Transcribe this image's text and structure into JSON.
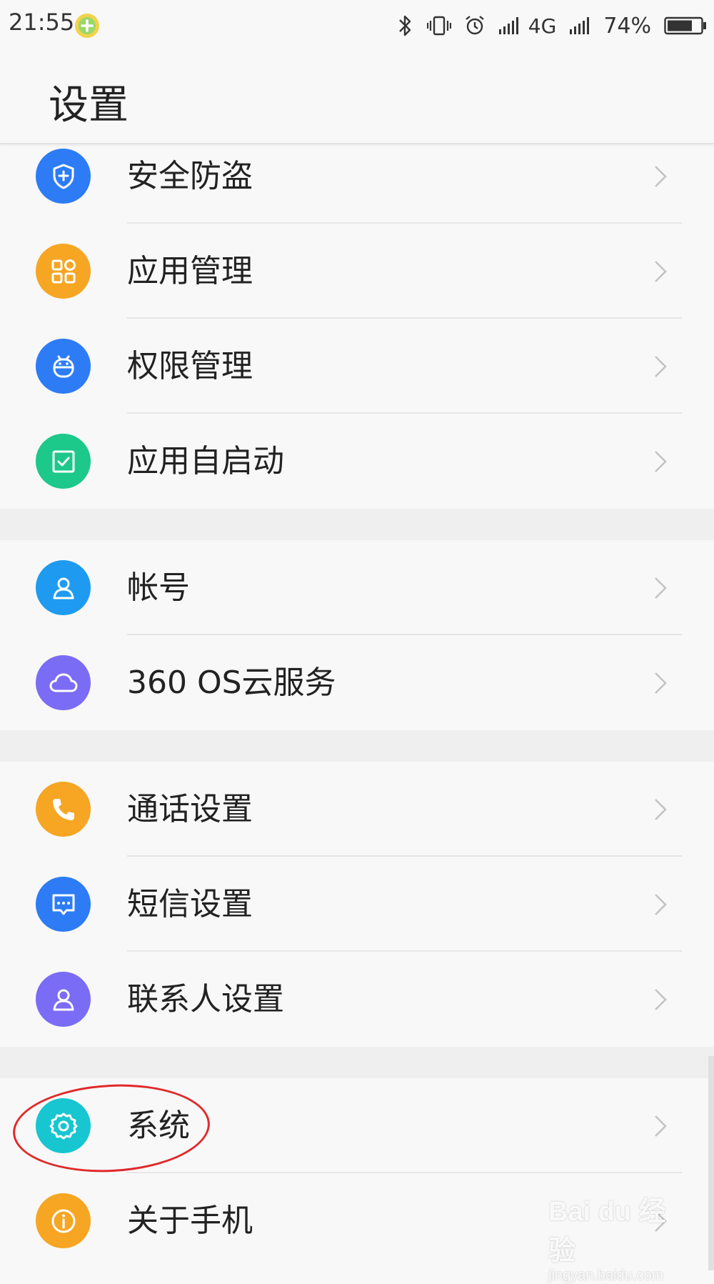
{
  "status_bar": {
    "time": "21:55",
    "network": "4G",
    "battery": "74%"
  },
  "header": {
    "title": "设置"
  },
  "groups": [
    {
      "items": [
        {
          "label": "安全防盗",
          "icon": "shield-plus-icon",
          "color": "#2D7CF6"
        },
        {
          "label": "应用管理",
          "icon": "apps-grid-icon",
          "color": "#F6A623"
        },
        {
          "label": "权限管理",
          "icon": "android-icon",
          "color": "#2D7CF6"
        },
        {
          "label": "应用自启动",
          "icon": "check-square-icon",
          "color": "#1CC88A"
        }
      ]
    },
    {
      "items": [
        {
          "label": "帐号",
          "icon": "user-icon",
          "color": "#1E9BF0"
        },
        {
          "label": "360 OS云服务",
          "icon": "cloud-icon",
          "color": "#7A6CF5"
        }
      ]
    },
    {
      "items": [
        {
          "label": "通话设置",
          "icon": "phone-icon",
          "color": "#F6A623"
        },
        {
          "label": "短信设置",
          "icon": "message-icon",
          "color": "#2D7CF6"
        },
        {
          "label": "联系人设置",
          "icon": "contact-icon",
          "color": "#7A6CF5"
        }
      ]
    },
    {
      "items": [
        {
          "label": "系统",
          "icon": "gear-icon",
          "color": "#17C6D0"
        },
        {
          "label": "关于手机",
          "icon": "info-icon",
          "color": "#F6A623"
        }
      ]
    }
  ],
  "watermark": {
    "main": "Bai du 经验",
    "sub": "jingyan.baidu.com"
  }
}
